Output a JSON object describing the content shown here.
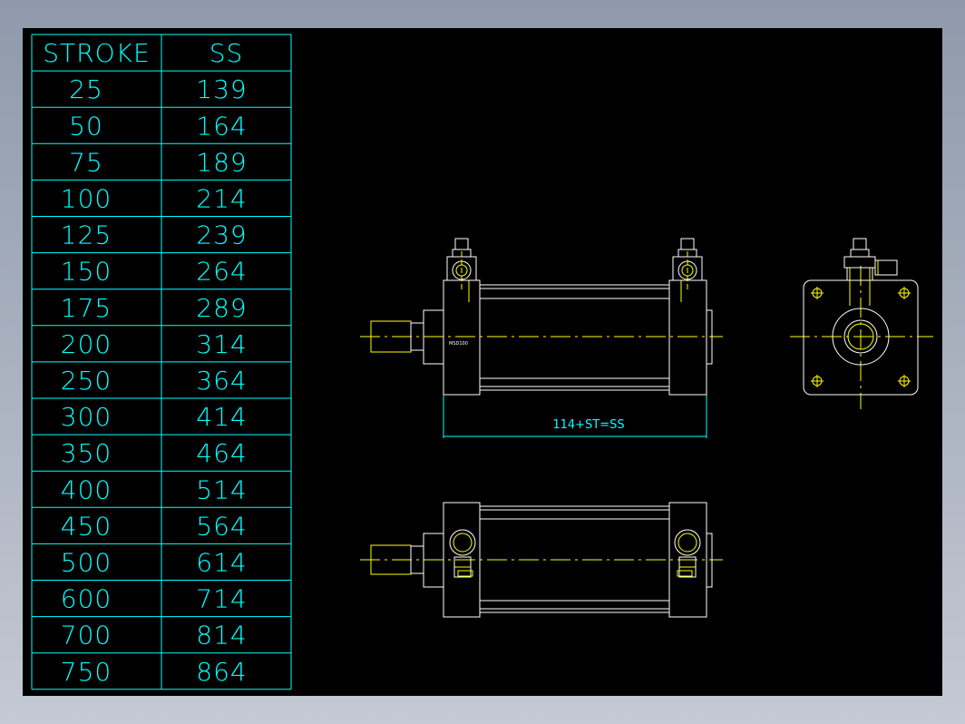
{
  "colors": {
    "background": "#000000",
    "table_lines": "#00ffff",
    "outline": "#ffffff",
    "detail": "#ffff00",
    "dimension": "#00ffff"
  },
  "table": {
    "headers": [
      "STROKE",
      "SS"
    ],
    "rows": [
      [
        "25",
        "139"
      ],
      [
        "50",
        "164"
      ],
      [
        "75",
        "189"
      ],
      [
        "100",
        "214"
      ],
      [
        "125",
        "239"
      ],
      [
        "150",
        "264"
      ],
      [
        "175",
        "289"
      ],
      [
        "200",
        "314"
      ],
      [
        "250",
        "364"
      ],
      [
        "300",
        "414"
      ],
      [
        "350",
        "464"
      ],
      [
        "400",
        "514"
      ],
      [
        "450",
        "564"
      ],
      [
        "500",
        "614"
      ],
      [
        "600",
        "714"
      ],
      [
        "700",
        "814"
      ],
      [
        "750",
        "864"
      ]
    ]
  },
  "drawing": {
    "dimension_label": "114+ST=SS",
    "model_label": "MSD100"
  }
}
